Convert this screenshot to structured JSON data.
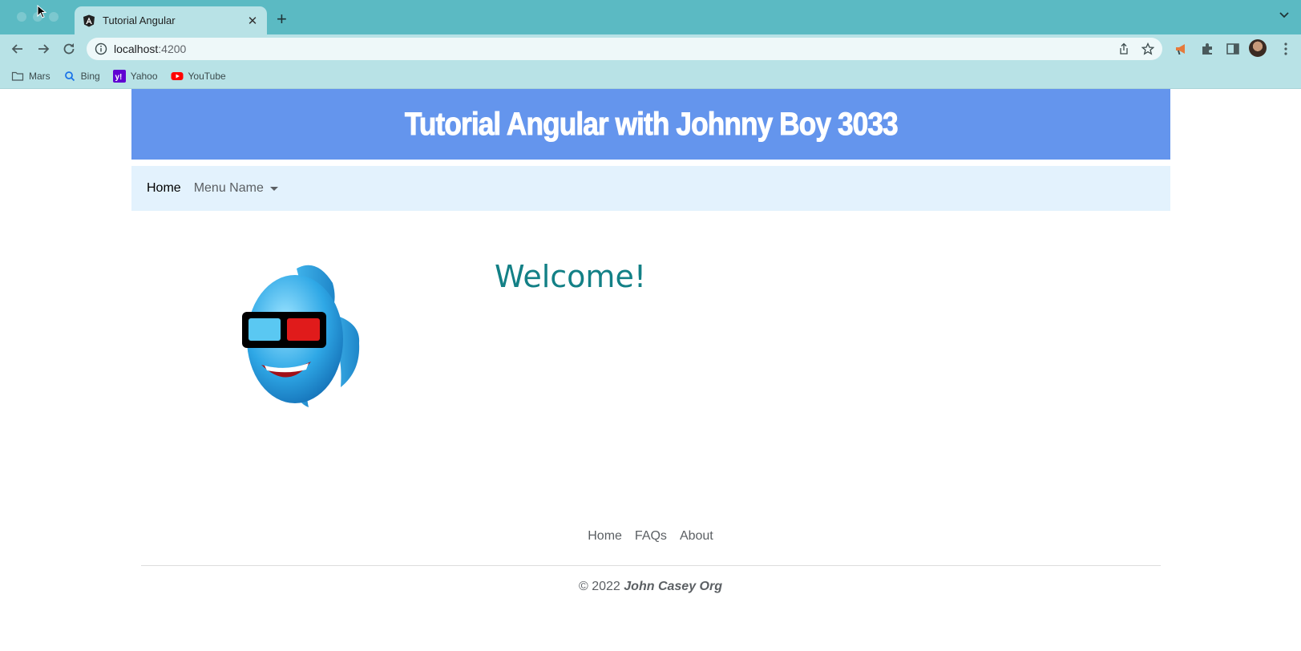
{
  "browser": {
    "tab_title": "Tutorial Angular",
    "url_host": "localhost",
    "url_port": ":4200",
    "bookmarks": [
      {
        "label": "Mars",
        "icon": "folder-icon"
      },
      {
        "label": "Bing",
        "icon": "search-icon"
      },
      {
        "label": "Yahoo",
        "icon": "yahoo-icon"
      },
      {
        "label": "YouTube",
        "icon": "youtube-icon"
      }
    ]
  },
  "site": {
    "banner_title": "Tutorial Angular with Johnny Boy 3033",
    "nav_home": "Home",
    "nav_menu": "Menu Name",
    "welcome": "Welcome!",
    "footer_links": [
      "Home",
      "FAQs",
      "About"
    ],
    "copyright_prefix": "© 2022",
    "copyright_org": "John Casey Org"
  },
  "colors": {
    "chrome": "#5bbac3",
    "toolbar": "#b8e2e6",
    "banner": "#6495ed",
    "navbar": "#e3f2fd",
    "welcome": "#138086"
  }
}
